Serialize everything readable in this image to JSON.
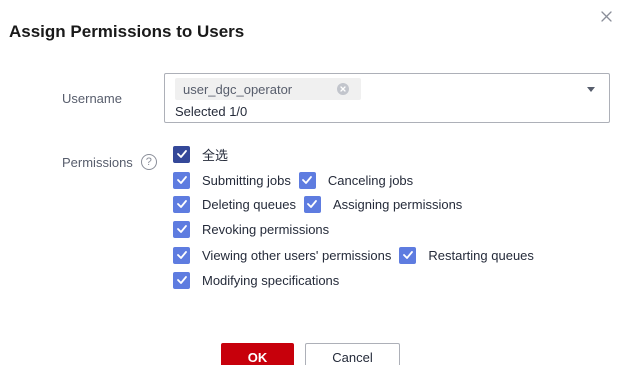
{
  "dialog": {
    "title": "Assign Permissions to Users",
    "close_icon": "close-icon"
  },
  "username": {
    "label": "Username",
    "selected_tag": "user_dgc_operator",
    "selected_count": "Selected 1/0"
  },
  "permissions": {
    "label": "Permissions",
    "help_symbol": "?",
    "select_all": "全选",
    "items": [
      "Submitting jobs",
      "Canceling jobs",
      "Deleting queues",
      "Assigning permissions",
      "Revoking permissions",
      "Viewing other users' permissions",
      "Restarting queues",
      "Modifying specifications"
    ],
    "all_checked": true
  },
  "footer": {
    "ok_label": "OK",
    "cancel_label": "Cancel"
  },
  "colors": {
    "checkbox_blue": "#5e7ce0",
    "checkbox_select_all": "#344899",
    "primary_button": "#c7000b"
  }
}
